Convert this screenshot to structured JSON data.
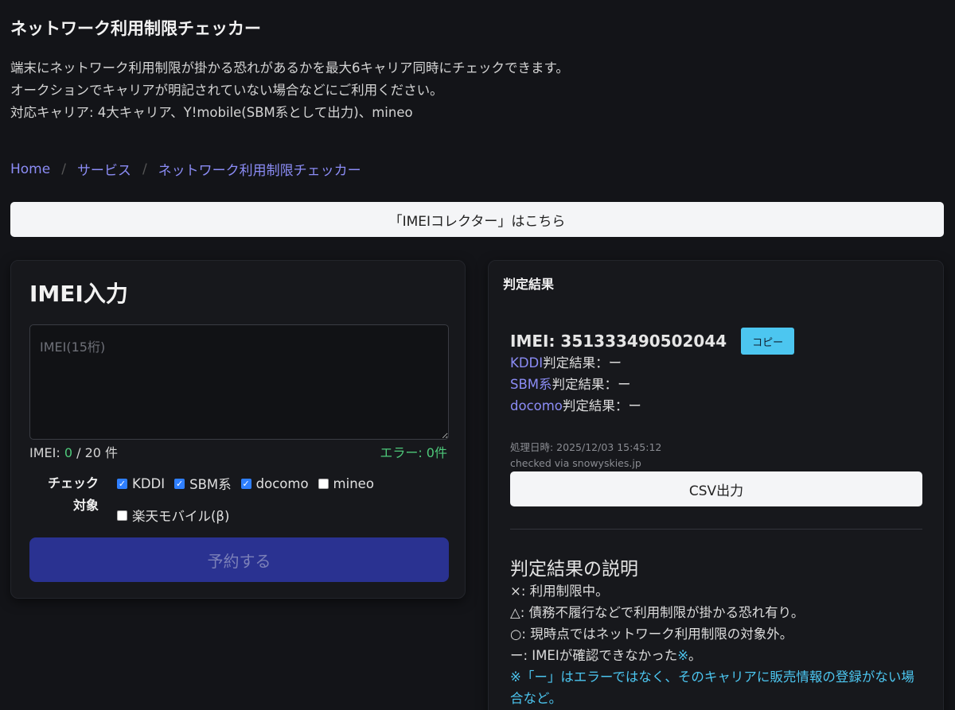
{
  "page": {
    "title": "ネットワーク利用制限チェッカー",
    "intro": [
      "端末にネットワーク利用制限が掛かる恐れがあるかを最大6キャリア同時にチェックできます。",
      "オークションでキャリアが明記されていない場合などにご利用ください。",
      "対応キャリア: 4大キャリア、Y!mobile(SBM系として出力)、mineo"
    ]
  },
  "breadcrumb": [
    "Home",
    "サービス",
    "ネットワーク利用制限チェッカー"
  ],
  "imei_collector_button": "「IMEIコレクター」はこちら",
  "input_card": {
    "title": "IMEI入力",
    "placeholder": "IMEI(15桁)",
    "value": "",
    "count_prefix": "IMEI: ",
    "count_value": "0",
    "count_suffix": " / 20 件",
    "error_label": "エラー: 0件",
    "check_label_line1": "チェック",
    "check_label_line2": "対象",
    "carriers": [
      {
        "label": "KDDI",
        "checked": true
      },
      {
        "label": "SBM系",
        "checked": true
      },
      {
        "label": "docomo",
        "checked": true
      },
      {
        "label": "mineo",
        "checked": false
      },
      {
        "label": "楽天モバイル(β)",
        "checked": false
      }
    ],
    "submit_label": "予約する"
  },
  "result_card": {
    "header": "判定結果",
    "imei_label": "IMEI: 351333490502044",
    "copy_label": "コピー",
    "results": [
      {
        "carrier": "KDDI",
        "suffix": "判定結果：ー"
      },
      {
        "carrier": "SBM系",
        "suffix": "判定結果：ー"
      },
      {
        "carrier": "docomo",
        "suffix": "判定結果：ー"
      }
    ],
    "processed_at": "処理日時: 2025/12/03 15:45:12",
    "checked_via": "checked via snowyskies.jp",
    "csv_label": "CSV出力",
    "explain_title": "判定結果の説明",
    "explain": [
      "×: 利用制限中。",
      "△: 債務不履行などで利用制限が掛かる恐れ有り。",
      "○: 現時点ではネットワーク利用制限の対象外。"
    ],
    "explain_dash": "ー: IMEIが確認できなかった",
    "explain_dash_mark": "※",
    "explain_dash_end": "。",
    "note": "※「ー」はエラーではなく、そのキャリアに販売情報の登録がない場合など。"
  },
  "colors": {
    "background": "#131418",
    "link": "#8b8cf5",
    "accent_green": "#4ec97a",
    "accent_cyan": "#4cc6f0",
    "primary_button": "#2a3291"
  }
}
